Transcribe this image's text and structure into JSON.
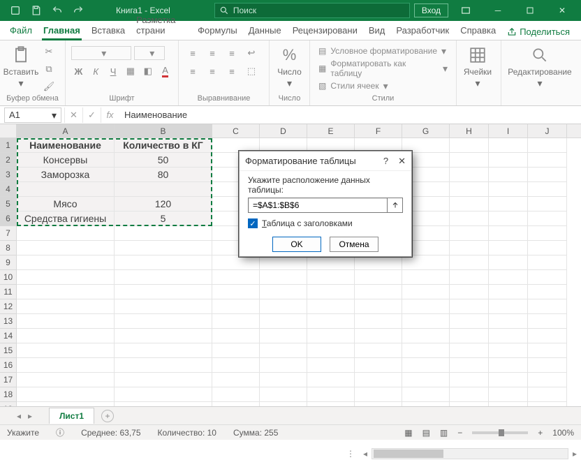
{
  "titlebar": {
    "doc": "Книга1 - Excel",
    "search_placeholder": "Поиск",
    "login": "Вход"
  },
  "tabs": {
    "file": "Файл",
    "items": [
      "Главная",
      "Вставка",
      "Разметка страни",
      "Формулы",
      "Данные",
      "Рецензировани",
      "Вид",
      "Разработчик",
      "Справка"
    ],
    "share": "Поделиться"
  },
  "ribbon": {
    "clipboard": {
      "paste": "Вставить",
      "label": "Буфер обмена"
    },
    "font": {
      "label": "Шрифт"
    },
    "align": {
      "label": "Выравнивание"
    },
    "number": {
      "btn": "Число",
      "label": "Число"
    },
    "styles": {
      "cond": "Условное форматирование",
      "fmt_table": "Форматировать как таблицу",
      "cell_styles": "Стили ячеек",
      "label": "Стили"
    },
    "cells": {
      "btn": "Ячейки"
    },
    "editing": {
      "btn": "Редактирование"
    }
  },
  "formula_bar": {
    "name": "A1",
    "fx": "fx",
    "value": "Наименование"
  },
  "grid": {
    "cols": [
      "A",
      "B",
      "C",
      "D",
      "E",
      "F",
      "G",
      "H",
      "I",
      "J"
    ],
    "rows": 19,
    "data": [
      {
        "a": "Наименование",
        "b": "Количество в КГ"
      },
      {
        "a": "Консервы",
        "b": "50"
      },
      {
        "a": "Заморозка",
        "b": "80"
      },
      {
        "a": "",
        "b": ""
      },
      {
        "a": "Мясо",
        "b": "120"
      },
      {
        "a": "Средства гигиены",
        "b": "5"
      }
    ]
  },
  "dialog": {
    "title": "Форматирование таблицы",
    "prompt": "Укажите расположение данных таблицы:",
    "range": "=$A$1:$B$6",
    "check_pre": "Т",
    "check_post": "аблица с заголовками",
    "ok": "OK",
    "cancel": "Отмена"
  },
  "sheet": {
    "name": "Лист1"
  },
  "status": {
    "mode": "Укажите",
    "avg_label": "Среднее:",
    "avg": "63,75",
    "count_label": "Количество:",
    "count": "10",
    "sum_label": "Сумма:",
    "sum": "255",
    "zoom": "100%"
  }
}
